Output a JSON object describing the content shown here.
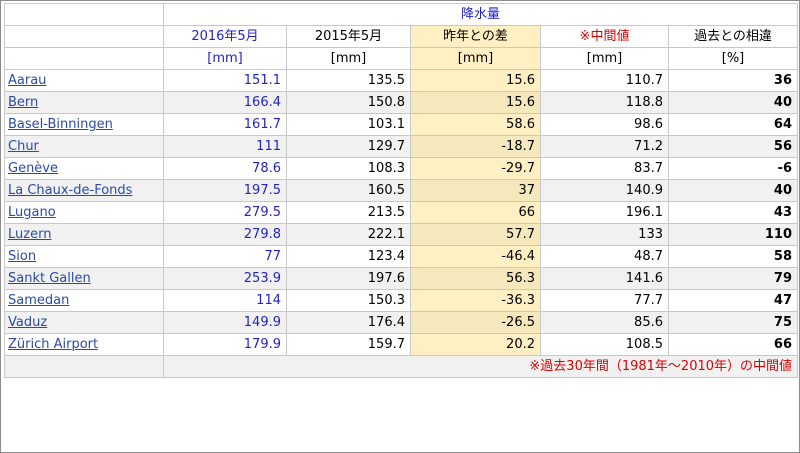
{
  "header": {
    "group_title": "降水量",
    "columns": [
      {
        "label": "2016年5月",
        "unit": "[mm]"
      },
      {
        "label": "2015年5月",
        "unit": "[mm]"
      },
      {
        "label": "昨年との差",
        "unit": "[mm]"
      },
      {
        "label": "※中間値",
        "unit": "[mm]"
      },
      {
        "label": "過去との相違",
        "unit": "[%]"
      }
    ]
  },
  "rows": [
    {
      "station": "Aarau",
      "v2016": "151.1",
      "v2015": "135.5",
      "diff": "15.6",
      "median": "110.7",
      "pct": "36"
    },
    {
      "station": "Bern",
      "v2016": "166.4",
      "v2015": "150.8",
      "diff": "15.6",
      "median": "118.8",
      "pct": "40"
    },
    {
      "station": "Basel-Binningen",
      "v2016": "161.7",
      "v2015": "103.1",
      "diff": "58.6",
      "median": "98.6",
      "pct": "64"
    },
    {
      "station": "Chur",
      "v2016": "111",
      "v2015": "129.7",
      "diff": "-18.7",
      "median": "71.2",
      "pct": "56"
    },
    {
      "station": "Genève",
      "v2016": "78.6",
      "v2015": "108.3",
      "diff": "-29.7",
      "median": "83.7",
      "pct": "-6"
    },
    {
      "station": "La Chaux-de-Fonds",
      "v2016": "197.5",
      "v2015": "160.5",
      "diff": "37",
      "median": "140.9",
      "pct": "40"
    },
    {
      "station": "Lugano",
      "v2016": "279.5",
      "v2015": "213.5",
      "diff": "66",
      "median": "196.1",
      "pct": "43"
    },
    {
      "station": "Luzern",
      "v2016": "279.8",
      "v2015": "222.1",
      "diff": "57.7",
      "median": "133",
      "pct": "110"
    },
    {
      "station": "Sion",
      "v2016": "77",
      "v2015": "123.4",
      "diff": "-46.4",
      "median": "48.7",
      "pct": "58"
    },
    {
      "station": "Sankt Gallen",
      "v2016": "253.9",
      "v2015": "197.6",
      "diff": "56.3",
      "median": "141.6",
      "pct": "79"
    },
    {
      "station": "Samedan",
      "v2016": "114",
      "v2015": "150.3",
      "diff": "-36.3",
      "median": "77.7",
      "pct": "47"
    },
    {
      "station": "Vaduz",
      "v2016": "149.9",
      "v2015": "176.4",
      "diff": "-26.5",
      "median": "85.6",
      "pct": "75"
    },
    {
      "station": "Zürich Airport",
      "v2016": "179.9",
      "v2015": "159.7",
      "diff": "20.2",
      "median": "108.5",
      "pct": "66"
    }
  ],
  "footnote": "※過去30年間（1981年～2010年）の中間値",
  "colors": {
    "link": "#2a4aa8",
    "col2016": "#2222cc",
    "median_header": "#e00000",
    "diff_highlight": "#fff0c4",
    "row_alt": "#f1f1f1"
  }
}
